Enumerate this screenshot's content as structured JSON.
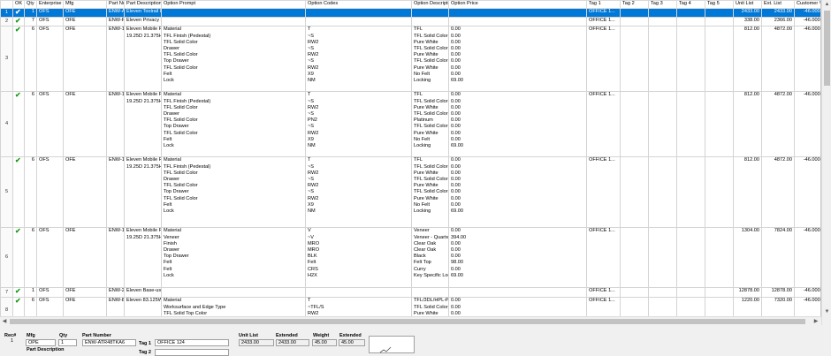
{
  "columns": [
    "OK",
    "Qty",
    "Enterprise Code",
    "Mfg",
    "Part Number",
    "Part Description",
    "Option Prompt",
    "Option Codes",
    "Option Descriptions",
    "Option Price",
    "Tag 1",
    "Tag 2",
    "Tag 3",
    "Tag 4",
    "Tag 5",
    "Unit List",
    "Ext. List",
    "Customer %",
    "Ur"
  ],
  "rows": [
    {
      "idx": "1",
      "ok": true,
      "qty": "1",
      "ent": "OFS",
      "mfg": "OFE",
      "part": "ENW-ATR48T...",
      "desc": [
        "Eleven Toolrail Kit-use w/ 1/4D privacy panels-(7) 48\" Toolrails"
      ],
      "prompts": [],
      "codes": [],
      "descs": [],
      "prices": [],
      "tag1": "OFFICE 1...",
      "unit": "2433.00",
      "ext": "2433.00",
      "cust": "-46.00000",
      "selected": true
    },
    {
      "idx": "2",
      "ok": true,
      "qty": "7",
      "ent": "OFS",
      "mfg": "OFE",
      "part": "ENW-PVPA-47...",
      "desc": [
        "Eleven Privacy Panel-Frosted Acrylic 47.625W 12.8125H"
      ],
      "prompts": [],
      "codes": [],
      "descs": [],
      "prices": [],
      "tag1": "OFFICE 1...",
      "unit": "338.00",
      "ext": "2366.00",
      "cust": "-46.00000"
    },
    {
      "idx": "3",
      "ok": true,
      "qty": "6",
      "ent": "OFS",
      "mfg": "OFE",
      "part": "ENW-1619MP",
      "desc": [
        "Eleven Mobile Pedestal, Box/File, Finished top, 15.625W",
        "19.25D 21.375H"
      ],
      "prompts": [
        "Material",
        "TFL Finish (Pedestal)",
        "TFL Solid Color",
        "Drawer",
        "TFL Solid Color",
        "Top Drawer",
        "TFL Solid Color",
        "Felt",
        "Lock"
      ],
      "codes": [
        "T",
        "~S",
        "RW2",
        "~S",
        "RW2",
        "~S",
        "RW2",
        "X9",
        "NM"
      ],
      "descs": [
        "TFL",
        "TFL Solid Color",
        "Pure White",
        "TFL Solid Color",
        "Pure White",
        "TFL Solid Color",
        "Pure White",
        "No Felt",
        "Locking"
      ],
      "prices": [
        "0.00",
        "0.00",
        "0.00",
        "0.00",
        "0.00",
        "0.00",
        "0.00",
        "0.00",
        "69.00"
      ],
      "tag1": "OFFICE 1...",
      "unit": "812.00",
      "ext": "4872.00",
      "cust": "-46.00000"
    },
    {
      "idx": "4",
      "ok": true,
      "qty": "6",
      "ent": "OFS",
      "mfg": "OFE",
      "part": "ENW-1619MP",
      "desc": [
        "Eleven Mobile Pedestal, Box/File, Finished top, 15.625W",
        "19.25D 21.375H"
      ],
      "prompts": [
        "Material",
        "TFL Finish (Pedestal)",
        "TFL Solid Color",
        "Drawer",
        "TFL Solid Color",
        "Top Drawer",
        "TFL Solid Color",
        "Felt",
        "Lock"
      ],
      "codes": [
        "T",
        "~S",
        "RW2",
        "~S",
        "PN2",
        "~S",
        "RW2",
        "X9",
        "NM"
      ],
      "descs": [
        "TFL",
        "TFL Solid Color",
        "Pure White",
        "TFL Solid Color",
        "Platinum",
        "TFL Solid Color",
        "Pure White",
        "No Felt",
        "Locking"
      ],
      "prices": [
        "0.00",
        "0.00",
        "0.00",
        "0.00",
        "0.00",
        "0.00",
        "0.00",
        "0.00",
        "69.00"
      ],
      "tag1": "OFFICE 1...",
      "unit": "812.00",
      "ext": "4872.00",
      "cust": "-46.00000"
    },
    {
      "idx": "5",
      "ok": true,
      "qty": "6",
      "ent": "OFS",
      "mfg": "OFE",
      "part": "ENW-1619MP",
      "desc": [
        "Eleven Mobile Pedestal, Box/File, Finished top, 15.625W",
        "19.25D 21.375H"
      ],
      "prompts": [
        "Material",
        "TFL Finish (Pedestal)",
        "TFL Solid Color",
        "Drawer",
        "TFL Solid Color",
        "Top Drawer",
        "TFL Solid Color",
        "Felt",
        "Lock"
      ],
      "codes": [
        "T",
        "~S",
        "RW2",
        "~S",
        "RW2",
        "~S",
        "RW2",
        "X9",
        "NM"
      ],
      "descs": [
        "TFL",
        "TFL Solid Color",
        "Pure White",
        "TFL Solid Color",
        "Pure White",
        "TFL Solid Color",
        "Pure White",
        "No Felt",
        "Locking"
      ],
      "prices": [
        "0.00",
        "0.00",
        "0.00",
        "0.00",
        "0.00",
        "0.00",
        "0.00",
        "0.00",
        "69.00"
      ],
      "tag1": "OFFICE 1...",
      "unit": "812.00",
      "ext": "4872.00",
      "cust": "-46.00000"
    },
    {
      "idx": "6",
      "ok": true,
      "qty": "6",
      "ent": "OFS",
      "mfg": "OFE",
      "part": "ENW-1619MP",
      "desc": [
        "Eleven Mobile Pedestal, Box/File, Finished top, 15.625W",
        "19.25D 21.375H"
      ],
      "prompts": [
        "Material",
        "Veneer",
        "Finish",
        "Drawer",
        "Top Drawer",
        "Felt",
        "Felt",
        "Lock"
      ],
      "codes": [
        "V",
        "~V",
        "MRO",
        "MRO",
        "BLK",
        "Felt",
        "CRS",
        "H2X"
      ],
      "descs": [
        "Veneer",
        "Veneer - Quartered",
        "Clear Oak",
        "Clear Oak",
        "Black",
        "Felt Top",
        "Curry",
        "Key Specific Locking"
      ],
      "prices": [
        "0.00",
        "394.00",
        "0.00",
        "0.00",
        "0.00",
        "98.00",
        "0.00",
        "69.00"
      ],
      "tag1": "OFFICE 1...",
      "unit": "1304.00",
      "ext": "7824.00",
      "cust": "-46.00000"
    },
    {
      "idx": "7",
      "ok": true,
      "qty": "1",
      "ent": "OFS",
      "mfg": "OFE",
      "part": "ENW-240111T...",
      "desc": [
        "Eleven Base-use w/ (6) ENW-8345CU & (2) ENW-4824BR"
      ],
      "prompts": [],
      "codes": [],
      "descs": [],
      "prices": [],
      "tag1": "OFFICE 1...",
      "unit": "12878.00",
      "ext": "12878.00",
      "cust": "-46.00000"
    },
    {
      "idx": "8",
      "ok": true,
      "qty": "6",
      "ent": "OFS",
      "mfg": "OFE",
      "part": "ENW-8345CU",
      "desc": [
        "Eleven 83.125W 47.75D Tri Cluster Worksurface (120 degree)"
      ],
      "prompts": [
        "Material",
        "Worksurface and Edge Type",
        "TFL Solid Top Color"
      ],
      "codes": [
        "T",
        "~TFL/S",
        "RW2"
      ],
      "descs": [
        "TFL/3DL/HPL-PVC Edge",
        "TFL Solid Color with 3mm PVC Edge",
        "Pure White"
      ],
      "prices": [
        "0.00",
        "0.00",
        "0.00"
      ],
      "tag1": "OFFICE 1...",
      "unit": "1220.00",
      "ext": "7320.00",
      "cust": "-46.00000"
    }
  ],
  "detail": {
    "rec_label": "Rec#",
    "rec_value": "1",
    "mfg_label": "Mfg",
    "mfg_value": "OPE",
    "qty_label": "Qty",
    "qty_value": "1",
    "part_label": "Part Number",
    "part_value": "ENW-ATR48TKA6",
    "tag1_label": "Tag 1",
    "tag1_value": "OFFICE 124",
    "tag2_label": "Tag 2",
    "desc_label": "Part Description",
    "unit_label": "Unit List",
    "unit_value": "2433.00",
    "ext_label": "Extended",
    "ext_value": "2433.00",
    "weight_label": "Weight",
    "weight_value": "45.00",
    "ext2_label": "Extended",
    "ext2_value": "45.00"
  },
  "colors": {
    "selection": "#0078d7",
    "check": "#1a9a1a"
  }
}
